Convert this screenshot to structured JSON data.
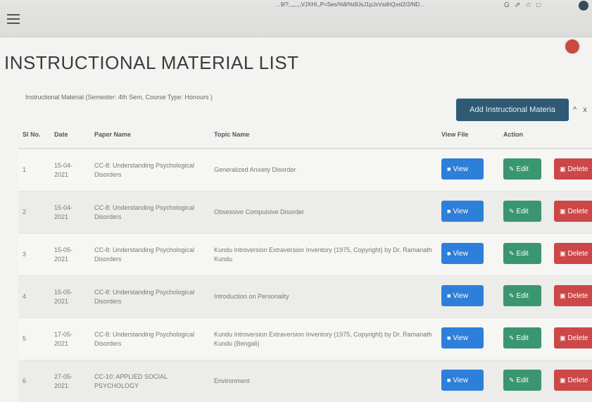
{
  "browser": {
    "url": "...9/?,,,,,,,,VJXHI,,P=Ses/%8/%t8JsJ1pJxVsdhQxsl2/2/ND...",
    "icons": [
      "G",
      "⇗",
      "☆",
      "□"
    ]
  },
  "page": {
    "title": "INSTRUCTIONAL MATERIAL LIST",
    "subtitle": "Instructional Material (Semester: 4th Sem, Course Type: Honours )",
    "add_button": "Add Instructional Materia",
    "panel_tools": "^ x"
  },
  "table": {
    "headers": [
      "Sl No.",
      "Date",
      "Paper Name",
      "Topic Name",
      "View File",
      "Action"
    ],
    "rows": [
      {
        "sl": "1",
        "date": "15-04-2021",
        "paper": "CC-8: Understanding Psychological Disorders",
        "topic": "Generalized Anxiety Disorder"
      },
      {
        "sl": "2",
        "date": "15-04-2021",
        "paper": "CC-8: Understanding Psychological Disorders",
        "topic": "Obsessive Compulsive Disorder"
      },
      {
        "sl": "3",
        "date": "15-05-2021",
        "paper": "CC-8: Understanding Psychological Disorders",
        "topic": "Kundu Introversion Extraversion Inventory (1975, Copyright) by Dr. Ramanath Kundu"
      },
      {
        "sl": "4",
        "date": "15-05-2021",
        "paper": "CC-8: Understanding Psychological Disorders",
        "topic": "Introduction on Personality"
      },
      {
        "sl": "5",
        "date": "17-05-2021",
        "paper": "CC-8: Understanding Psychological Disorders",
        "topic": "Kundu Introversion Extraversion Inventory (1975, Copyright) by Dr. Ramanath Kundu (Bengali)"
      },
      {
        "sl": "6",
        "date": "27-05-2021",
        "paper": "CC-10: APPLIED SOCIAL PSYCHOLOGY",
        "topic": "Environment"
      }
    ],
    "view_label": "View",
    "edit_label": "Edit",
    "delete_label": "Delete"
  },
  "colors": {
    "view": "#2e7fd9",
    "edit": "#3a9670",
    "delete": "#cc4747",
    "add": "#2f5a73"
  }
}
